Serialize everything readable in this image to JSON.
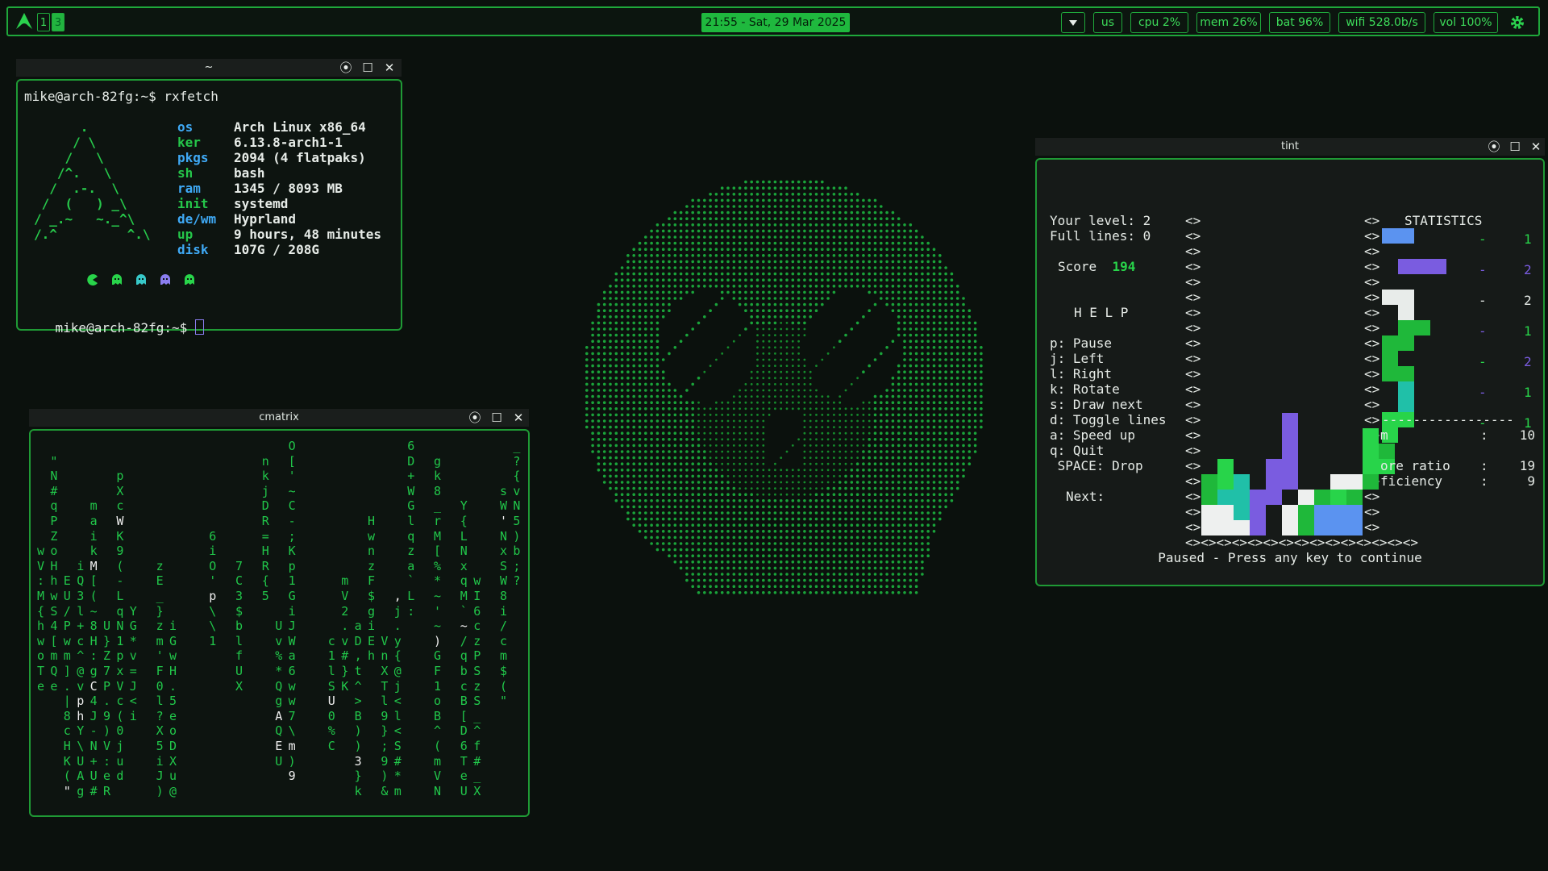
{
  "topbar": {
    "workspaces": [
      "1",
      "3"
    ],
    "active_workspace": "3",
    "clock": "21:55 - Sat, 29 Mar 2025",
    "tray_icon": "dropdown-arrow",
    "modules": {
      "lang": "us",
      "cpu": "cpu 2%",
      "mem": "mem 26%",
      "bat": "bat 96%",
      "wifi": "wifi 528.0b/s",
      "vol": "vol 100%"
    },
    "accent": "#1fb83e"
  },
  "rxfetch": {
    "title": "~",
    "prompt1": "mike@arch-82fg:~$ rxfetch",
    "fields": [
      {
        "k": "os",
        "v": "Arch Linux x86_64"
      },
      {
        "k": "ker",
        "v": "6.13.8-arch1-1"
      },
      {
        "k": "pkgs",
        "v": "2094 (4 flatpaks)"
      },
      {
        "k": "sh",
        "v": "bash"
      },
      {
        "k": "ram",
        "v": "1345 / 8093 MB"
      },
      {
        "k": "init",
        "v": "systemd"
      },
      {
        "k": "de/wm",
        "v": "Hyprland"
      },
      {
        "k": "up",
        "v": "9 hours, 48 minutes"
      },
      {
        "k": "disk",
        "v": "107G / 208G"
      }
    ],
    "logo": [
      "      .",
      "     / \\",
      "    /   \\",
      "   /^.   \\",
      "  /  .-.  \\",
      " /  (   ) _\\",
      "/ _.~   ~._^\\",
      "/.^         ^.\\"
    ],
    "prompt2": "mike@arch-82fg:~$"
  },
  "cmatrix": {
    "title": "cmatrix"
  },
  "tint": {
    "title": "tint",
    "level": "Your level: 2",
    "lines": "Full lines: 0",
    "score_label": "Score",
    "score": "194",
    "help_title": "H E L P",
    "help": [
      "p: Pause",
      "j: Left",
      "l: Right",
      "k: Rotate",
      "s: Draw next",
      "d: Toggle lines",
      "a: Speed up",
      "q: Quit",
      " SPACE: Drop"
    ],
    "next_label": "Next:",
    "stats_title": "STATISTICS",
    "stats": [
      {
        "color": "#5b93f0",
        "count": "1"
      },
      {
        "color": "#7a5ce0",
        "count": "2"
      },
      {
        "color": "#e8ecea",
        "count": "2"
      },
      {
        "color": "#1fb83a",
        "count": "1"
      },
      {
        "color": "#1fb83a",
        "count": "2"
      },
      {
        "color": "#20c0a8",
        "count": "1"
      },
      {
        "color": "#28d44a",
        "count": "1"
      }
    ],
    "sum_lines": [
      {
        "label": "m",
        "value": "10"
      },
      {
        "label": "ore ratio",
        "value": "19"
      },
      {
        "label": "ficiency",
        "value": "9"
      }
    ],
    "paused": "Paused - Press any key to continue"
  }
}
